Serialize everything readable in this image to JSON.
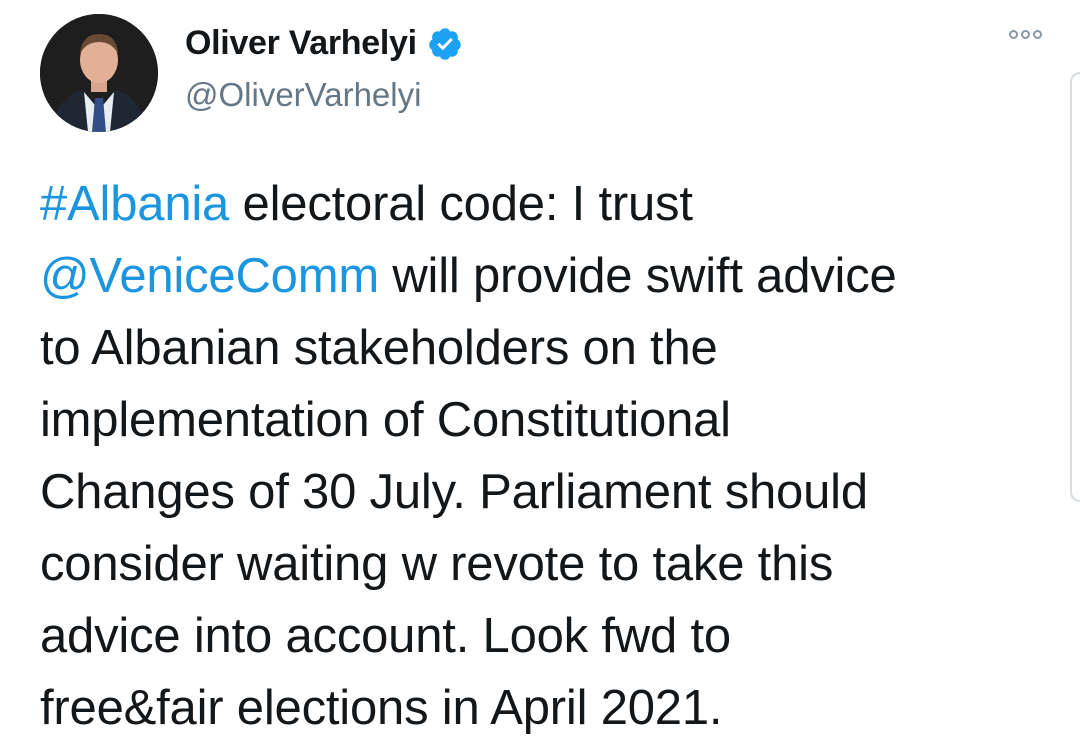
{
  "author": {
    "display_name": "Oliver Varhelyi",
    "handle": "@OliverVarhelyi",
    "verified": true,
    "avatar_icon": "profile-photo"
  },
  "colors": {
    "link": "#1b95e0",
    "text": "#14171a",
    "handle": "#657786",
    "verified_badge": "#1da1f2"
  },
  "tweet": {
    "lines": [
      {
        "parts": [
          {
            "text": "#Albania",
            "link": true
          },
          {
            "text": " electoral code: I trust",
            "link": false
          }
        ]
      },
      {
        "parts": [
          {
            "text": "@VeniceComm",
            "link": true
          },
          {
            "text": " will provide swift advice",
            "link": false
          }
        ]
      },
      {
        "parts": [
          {
            "text": "to Albanian stakeholders on the",
            "link": false
          }
        ]
      },
      {
        "parts": [
          {
            "text": "implementation of Constitutional",
            "link": false
          }
        ]
      },
      {
        "parts": [
          {
            "text": "Changes of 30 July. Parliament should",
            "link": false
          }
        ]
      },
      {
        "parts": [
          {
            "text": "consider waiting w revote to take this",
            "link": false
          }
        ]
      },
      {
        "parts": [
          {
            "text": "advice into account. Look fwd to",
            "link": false
          }
        ]
      },
      {
        "parts": [
          {
            "text": "free&fair elections in April 2021.",
            "link": false
          }
        ]
      }
    ]
  },
  "menu_icon": "more-options-icon"
}
